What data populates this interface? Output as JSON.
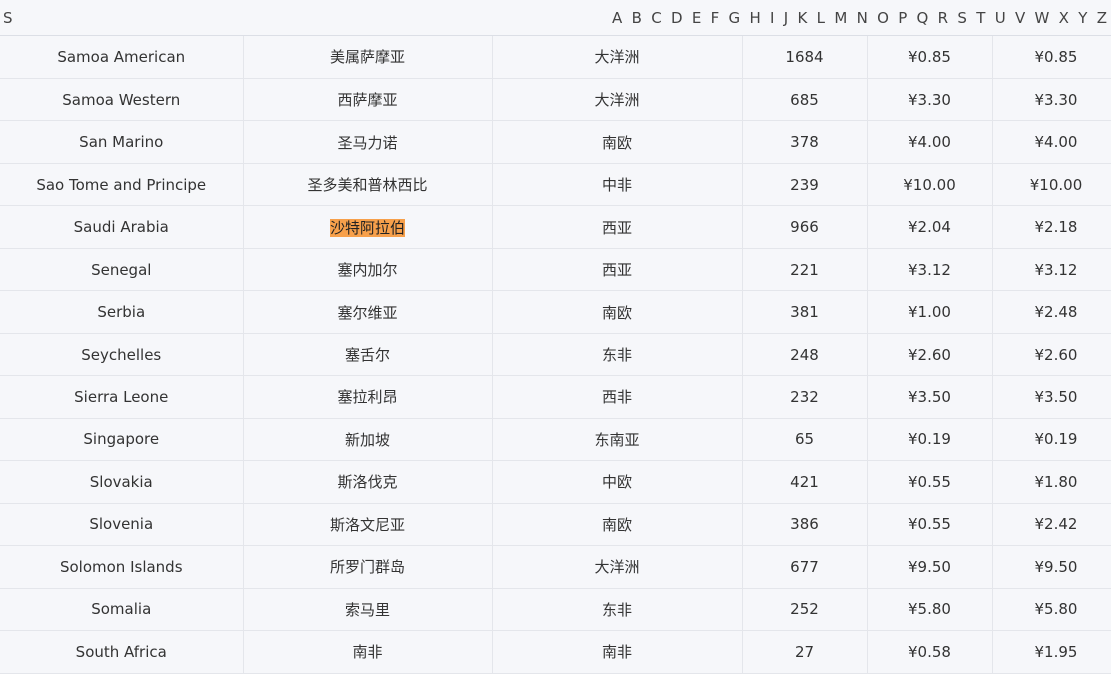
{
  "index": {
    "current": "S",
    "letters": [
      "A",
      "B",
      "C",
      "D",
      "E",
      "F",
      "G",
      "H",
      "I",
      "J",
      "K",
      "L",
      "M",
      "N",
      "O",
      "P",
      "Q",
      "R",
      "S",
      "T",
      "U",
      "V",
      "W",
      "X",
      "Y",
      "Z"
    ]
  },
  "highlight_color": "#f7a04b",
  "rows": [
    {
      "en": "Samoa American",
      "cn": "美属萨摩亚",
      "region": "大洋洲",
      "code": "1684",
      "p1": "¥0.85",
      "p2": "¥0.85"
    },
    {
      "en": "Samoa Western",
      "cn": "西萨摩亚",
      "region": "大洋洲",
      "code": "685",
      "p1": "¥3.30",
      "p2": "¥3.30"
    },
    {
      "en": "San Marino",
      "cn": "圣马力诺",
      "region": "南欧",
      "code": "378",
      "p1": "¥4.00",
      "p2": "¥4.00"
    },
    {
      "en": "Sao Tome and Principe",
      "cn": "圣多美和普林西比",
      "region": "中非",
      "code": "239",
      "p1": "¥10.00",
      "p2": "¥10.00"
    },
    {
      "en": "Saudi Arabia",
      "cn": "沙特阿拉伯",
      "region": "西亚",
      "code": "966",
      "p1": "¥2.04",
      "p2": "¥2.18",
      "highlighted": true
    },
    {
      "en": "Senegal",
      "cn": "塞内加尔",
      "region": "西亚",
      "code": "221",
      "p1": "¥3.12",
      "p2": "¥3.12"
    },
    {
      "en": "Serbia",
      "cn": "塞尔维亚",
      "region": "南欧",
      "code": "381",
      "p1": "¥1.00",
      "p2": "¥2.48"
    },
    {
      "en": "Seychelles",
      "cn": "塞舌尔",
      "region": "东非",
      "code": "248",
      "p1": "¥2.60",
      "p2": "¥2.60"
    },
    {
      "en": "Sierra Leone",
      "cn": "塞拉利昂",
      "region": "西非",
      "code": "232",
      "p1": "¥3.50",
      "p2": "¥3.50"
    },
    {
      "en": "Singapore",
      "cn": "新加坡",
      "region": "东南亚",
      "code": "65",
      "p1": "¥0.19",
      "p2": "¥0.19"
    },
    {
      "en": "Slovakia",
      "cn": "斯洛伐克",
      "region": "中欧",
      "code": "421",
      "p1": "¥0.55",
      "p2": "¥1.80"
    },
    {
      "en": "Slovenia",
      "cn": "斯洛文尼亚",
      "region": "南欧",
      "code": "386",
      "p1": "¥0.55",
      "p2": "¥2.42"
    },
    {
      "en": "Solomon Islands",
      "cn": "所罗门群岛",
      "region": "大洋洲",
      "code": "677",
      "p1": "¥9.50",
      "p2": "¥9.50"
    },
    {
      "en": "Somalia",
      "cn": "索马里",
      "region": "东非",
      "code": "252",
      "p1": "¥5.80",
      "p2": "¥5.80"
    },
    {
      "en": "South Africa",
      "cn": "南非",
      "region": "南非",
      "code": "27",
      "p1": "¥0.58",
      "p2": "¥1.95"
    }
  ]
}
